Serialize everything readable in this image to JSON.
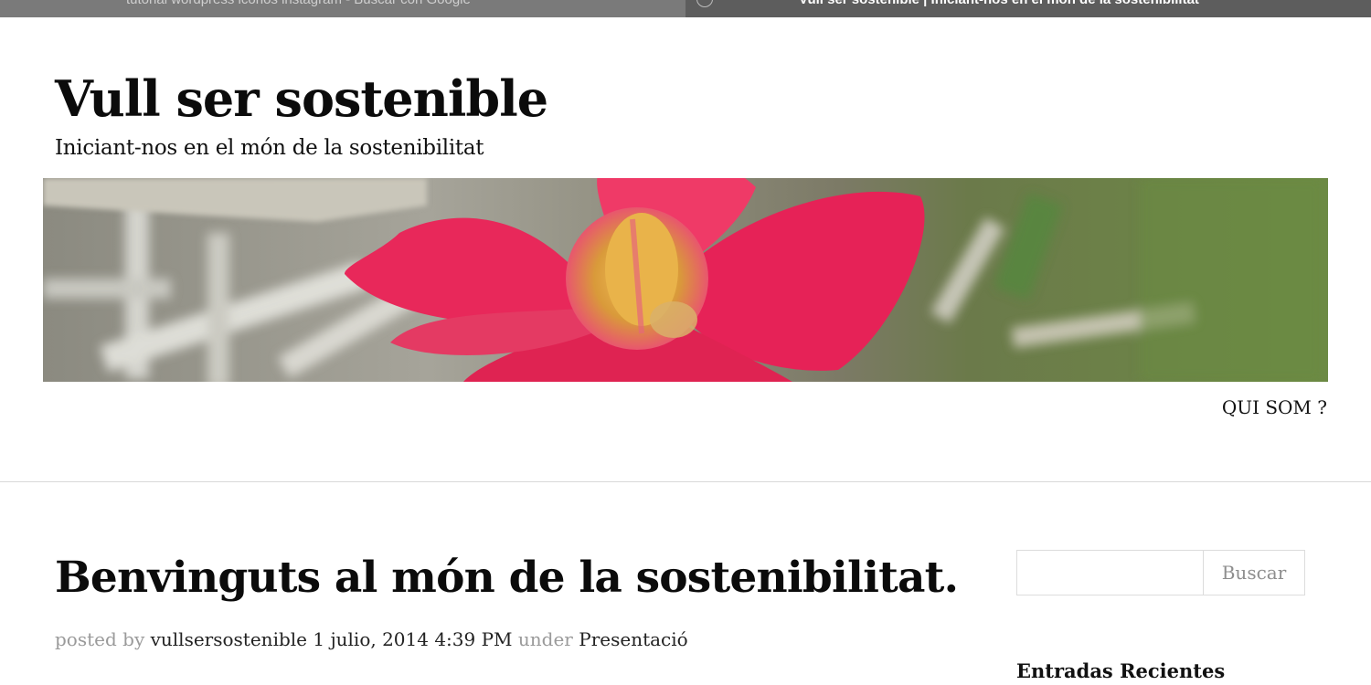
{
  "browser": {
    "tabs": [
      {
        "title": "tutorial wordpress iconos instagram - Buscar con Google",
        "active": false
      },
      {
        "title": "Vull ser sostenible | Iniciant-nos en el món de la sostenibilitat",
        "active": true
      }
    ]
  },
  "header": {
    "site_title": "Vull ser sostenible",
    "tagline": "Iniciant-nos en el món de la sostenibilitat",
    "banner_icon": "flower-photo"
  },
  "nav": {
    "items": [
      {
        "label": "QUI SOM ?"
      }
    ]
  },
  "post": {
    "title": "Benvinguts al món de la sostenibilitat.",
    "meta": {
      "posted_by_label": "posted by",
      "author": "vullsersostenible",
      "date": "1 julio, 2014 4:39 PM",
      "under_label": "under",
      "category": "Presentació"
    }
  },
  "sidebar": {
    "search": {
      "placeholder": "",
      "button_label": "Buscar"
    },
    "recent_posts_title": "Entradas Recientes"
  },
  "colors": {
    "tab_inactive": "#7a7a7a",
    "tab_active": "#5d5d5d",
    "text": "#111111",
    "muted": "#9a9a9a",
    "divider": "#d9d9d9",
    "flower": "#e8285a"
  }
}
